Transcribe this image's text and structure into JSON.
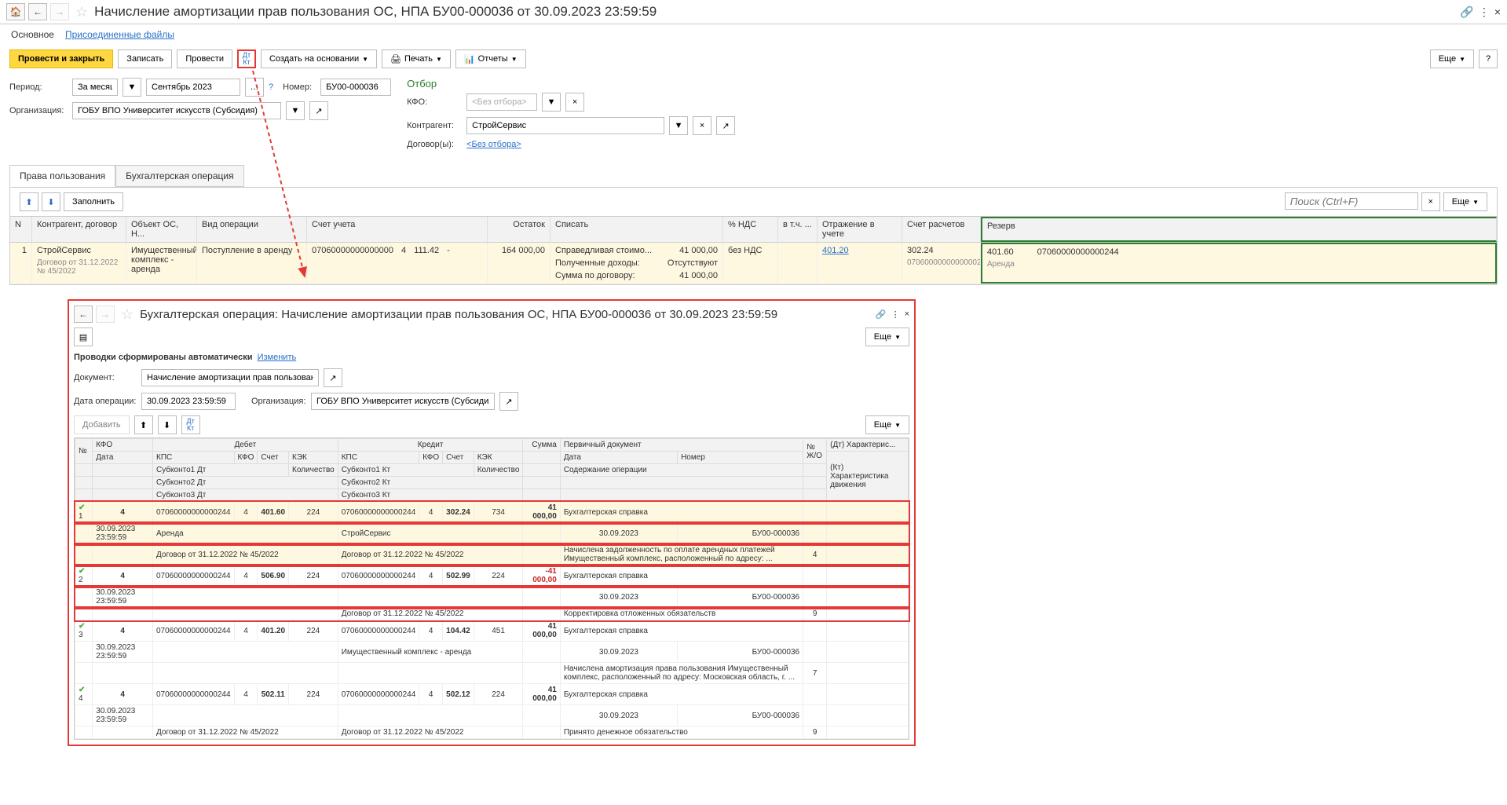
{
  "header": {
    "title": "Начисление амортизации прав пользования ОС, НПА БУ00-000036 от 30.09.2023 23:59:59"
  },
  "subtabs": {
    "main": "Основное",
    "files": "Присоединенные файлы"
  },
  "toolbar": {
    "submit_close": "Провести и закрыть",
    "save": "Записать",
    "submit": "Провести",
    "create_based": "Создать на основании",
    "print": "Печать",
    "reports": "Отчеты",
    "more": "Еще"
  },
  "form": {
    "period_label": "Период:",
    "period_type": "За месяц",
    "period_value": "Сентябрь 2023",
    "number_label": "Номер:",
    "number": "БУ00-000036",
    "org_label": "Организация:",
    "org": "ГОБУ ВПО Университет искусств (Субсидия)",
    "filter_title": "Отбор",
    "kfo_label": "КФО:",
    "kfo_placeholder": "<Без отбора>",
    "kontr_label": "Контрагент:",
    "kontr_value": "СтройСервис",
    "dogov_label": "Договор(ы):",
    "dogov_link": "<Без отбора>"
  },
  "tabs": {
    "rights": "Права пользования",
    "accop": "Бухгалтерская операция"
  },
  "doc_toolbar": {
    "fill": "Заполнить",
    "search_placeholder": "Поиск (Ctrl+F)",
    "more": "Еще"
  },
  "grid": {
    "headers": [
      "N",
      "Контрагент, договор",
      "Объект ОС, Н...",
      "Вид операции",
      "Счет учета",
      "Остаток",
      "Списать",
      "% НДС",
      "в т.ч. ...",
      "Отражение в учете",
      "Счет расчетов",
      "Резерв"
    ],
    "row1": {
      "n": "1",
      "kontr": "СтройСервис",
      "kontr_sub": "Договор от 31.12.2022 № 45/2022",
      "obj": "Имущественный комплекс - аренда",
      "vid": "Поступление в аренду",
      "schet": "07060000000000000",
      "schet2": "4",
      "schet3": "111.42",
      "schet4": "-",
      "ost": "164 000,00",
      "spisat1": "Справедливая стоимо...",
      "spisat1v": "41 000,00",
      "spisat2": "Полученные доходы:",
      "spisat2v": "Отсутствуют",
      "spisat3": "Сумма по договору:",
      "spisat3v": "41 000,00",
      "nds": "без НДС",
      "otraz": "401.20",
      "raschet": "302.24",
      "raschet_sub": "07060000000000002",
      "rezerv1": "401.60",
      "rezerv2": "07060000000000244",
      "rezerv3": "Аренда"
    }
  },
  "child": {
    "title": "Бухгалтерская операция: Начисление амортизации прав пользования ОС, НПА БУ00-000036 от 30.09.2023 23:59:59",
    "auto": "Проводки сформированы автоматически",
    "change": "Изменить",
    "doc_label": "Документ:",
    "doc_value": "Начисление амортизации прав пользования ОС, НПА Б",
    "date_label": "Дата операции:",
    "date_value": "30.09.2023 23:59:59",
    "org_label": "Организация:",
    "org_value": "ГОБУ ВПО Университет искусств (Субсидия)",
    "add": "Добавить",
    "more": "Еще",
    "head": {
      "n": "№",
      "kfo": "КФО",
      "debet": "Дебет",
      "kredit": "Кредит",
      "summa": "Сумма",
      "perv": "Первичный документ",
      "dt_har": "(Дт) Характерис...",
      "data": "Дата",
      "kps": "КПС",
      "kfo2": "КФО",
      "schet": "Счет",
      "kek": "КЭК",
      "nomer": "Номер",
      "nzh": "№ Ж/О",
      "kt": "(Кт)",
      "har": "Характеристика движения",
      "sub1d": "Субконто1 Дт",
      "sub2d": "Субконто2 Дт",
      "sub3d": "Субконто3 Дт",
      "sub1k": "Субконто1 Кт",
      "sub2k": "Субконто2 Кт",
      "sub3k": "Субконто3 Кт",
      "kol": "Количество",
      "soder": "Содержание операции"
    },
    "rows": [
      {
        "n": "1",
        "kfo": "4",
        "date": "30.09.2023 23:59:59",
        "d_kps": "07060000000000244",
        "d_kfo": "4",
        "d_schet": "401.60",
        "d_kek": "224",
        "d_sub1": "Аренда",
        "d_sub2": "Договор от 31.12.2022 № 45/2022",
        "k_kps": "07060000000000244",
        "k_kfo": "4",
        "k_schet": "302.24",
        "k_kek": "734",
        "k_sub1": "СтройСервис",
        "k_sub2": "Договор от 31.12.2022 № 45/2022",
        "summa": "41 000,00",
        "perv": "Бухгалтерская справка",
        "pdate": "30.09.2023",
        "pnomer": "БУ00-000036",
        "soder": "Начислена задолженность по оплате арендных платежей Имущественный комплекс, расположенный по адресу: ...",
        "nzh": "4",
        "hl": true
      },
      {
        "n": "2",
        "kfo": "4",
        "date": "30.09.2023 23:59:59",
        "d_kps": "07060000000000244",
        "d_kfo": "4",
        "d_schet": "506.90",
        "d_kek": "224",
        "k_kps": "07060000000000244",
        "k_kfo": "4",
        "k_schet": "502.99",
        "k_kek": "224",
        "k_sub2": "Договор от 31.12.2022 № 45/2022",
        "summa": "-41 000,00",
        "neg": true,
        "perv": "Бухгалтерская справка",
        "pdate": "30.09.2023",
        "pnomer": "БУ00-000036",
        "soder": "Корректировка отложенных обязательств",
        "nzh": "9",
        "hl": false
      },
      {
        "n": "3",
        "kfo": "4",
        "date": "30.09.2023 23:59:59",
        "d_kps": "07060000000000244",
        "d_kfo": "4",
        "d_schet": "401.20",
        "d_kek": "224",
        "k_kps": "07060000000000244",
        "k_kfo": "4",
        "k_schet": "104.42",
        "k_kek": "451",
        "k_sub1": "Имущественный комплекс - аренда",
        "summa": "41 000,00",
        "perv": "Бухгалтерская справка",
        "pdate": "30.09.2023",
        "pnomer": "БУ00-000036",
        "soder": "Начислена амортизация права пользования Имущественный комплекс, расположенный по адресу: Московская область, г. ...",
        "nzh": "7",
        "hl": false
      },
      {
        "n": "4",
        "kfo": "4",
        "date": "30.09.2023 23:59:59",
        "d_kps": "07060000000000244",
        "d_kfo": "4",
        "d_schet": "502.11",
        "d_kek": "224",
        "d_sub2": "Договор от 31.12.2022 № 45/2022",
        "k_kps": "07060000000000244",
        "k_kfo": "4",
        "k_schet": "502.12",
        "k_kek": "224",
        "k_sub2": "Договор от 31.12.2022 № 45/2022",
        "summa": "41 000,00",
        "perv": "Бухгалтерская справка",
        "pdate": "30.09.2023",
        "pnomer": "БУ00-000036",
        "soder": "Принято денежное обязательство",
        "nzh": "9",
        "hl": false
      }
    ]
  }
}
